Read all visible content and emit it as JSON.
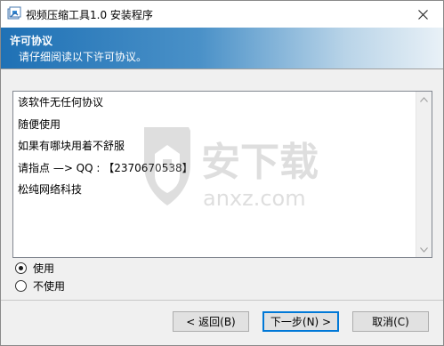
{
  "window": {
    "title": "视频压缩工具1.0 安装程序"
  },
  "header": {
    "title": "许可协议",
    "subtitle": "请仔细阅读以下许可协议。"
  },
  "license": {
    "lines": [
      "该软件无任何协议",
      "随便使用",
      "如果有哪块用着不舒服",
      "请指点 —> QQ : 【2370670538】",
      "松纯网络科技"
    ]
  },
  "watermark": {
    "text": "安下载",
    "subtext": "anxz.com"
  },
  "options": {
    "accept_label": "使用",
    "decline_label": "不使用",
    "selected": "accept"
  },
  "buttons": {
    "back_label": "< 返回(B)",
    "next_label": "下一步(N) >",
    "cancel_label": "取消(C)"
  },
  "colors": {
    "header_start": "#1f71b5",
    "header_end": "#e9f1f7",
    "default_button_border": "#0078d7"
  }
}
